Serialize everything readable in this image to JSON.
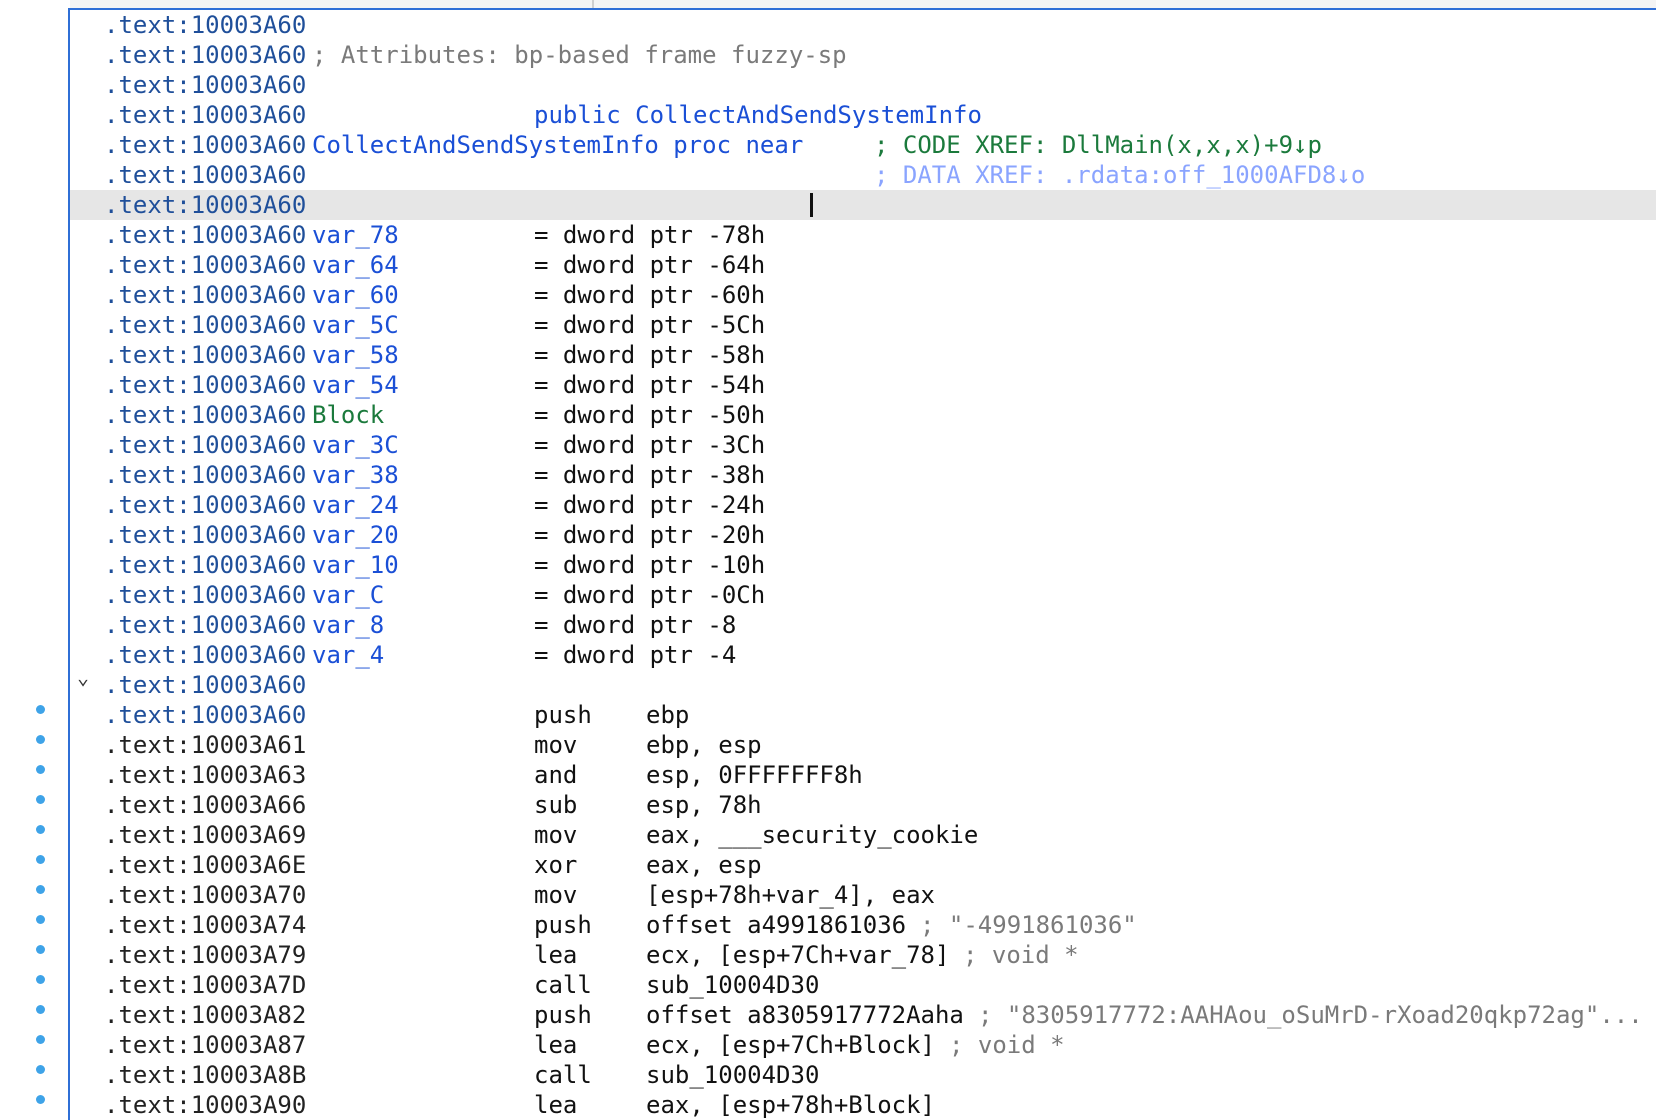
{
  "disassembly": {
    "header_lines": [
      {
        "addr": ".text:10003A60",
        "name": "",
        "comment": ""
      },
      {
        "addr": ".text:10003A60",
        "name": "",
        "comment": "; Attributes: bp-based frame fuzzy-sp"
      },
      {
        "addr": ".text:10003A60",
        "name": "",
        "comment": ""
      },
      {
        "addr": ".text:10003A60",
        "name": "",
        "public": "public CollectAndSendSystemInfo"
      },
      {
        "addr": ".text:10003A60",
        "name": "CollectAndSendSystemInfo proc near",
        "xref": "; CODE XREF: DllMain(x,x,x)+9↓p"
      },
      {
        "addr": ".text:10003A60",
        "name": "",
        "xref": "; DATA XREF: .rdata:off_1000AFD8↓o"
      },
      {
        "addr": ".text:10003A60",
        "name": "",
        "cursor": true
      }
    ],
    "vars": [
      {
        "addr": ".text:10003A60",
        "name": "var_78",
        "def": "= dword ptr -78h"
      },
      {
        "addr": ".text:10003A60",
        "name": "var_64",
        "def": "= dword ptr -64h"
      },
      {
        "addr": ".text:10003A60",
        "name": "var_60",
        "def": "= dword ptr -60h"
      },
      {
        "addr": ".text:10003A60",
        "name": "var_5C",
        "def": "= dword ptr -5Ch"
      },
      {
        "addr": ".text:10003A60",
        "name": "var_58",
        "def": "= dword ptr -58h"
      },
      {
        "addr": ".text:10003A60",
        "name": "var_54",
        "def": "= dword ptr -54h"
      },
      {
        "addr": ".text:10003A60",
        "name": "Block",
        "def": "= dword ptr -50h"
      },
      {
        "addr": ".text:10003A60",
        "name": "var_3C",
        "def": "= dword ptr -3Ch"
      },
      {
        "addr": ".text:10003A60",
        "name": "var_38",
        "def": "= dword ptr -38h"
      },
      {
        "addr": ".text:10003A60",
        "name": "var_24",
        "def": "= dword ptr -24h"
      },
      {
        "addr": ".text:10003A60",
        "name": "var_20",
        "def": "= dword ptr -20h"
      },
      {
        "addr": ".text:10003A60",
        "name": "var_10",
        "def": "= dword ptr -10h"
      },
      {
        "addr": ".text:10003A60",
        "name": "var_C",
        "def": "= dword ptr -0Ch"
      },
      {
        "addr": ".text:10003A60",
        "name": "var_8",
        "def": "= dword ptr -8"
      },
      {
        "addr": ".text:10003A60",
        "name": "var_4",
        "def": "= dword ptr -4"
      }
    ],
    "blank_addr": ".text:10003A60",
    "code": [
      {
        "addr": ".text:10003A60",
        "mn": "push",
        "op": "ebp",
        "cmt": ""
      },
      {
        "addr": ".text:10003A61",
        "mn": "mov",
        "op": "ebp, esp",
        "cmt": ""
      },
      {
        "addr": ".text:10003A63",
        "mn": "and",
        "op": "esp, 0FFFFFFF8h",
        "cmt": ""
      },
      {
        "addr": ".text:10003A66",
        "mn": "sub",
        "op": "esp, 78h",
        "cmt": ""
      },
      {
        "addr": ".text:10003A69",
        "mn": "mov",
        "op": "eax, ___security_cookie",
        "cmt": ""
      },
      {
        "addr": ".text:10003A6E",
        "mn": "xor",
        "op": "eax, esp",
        "cmt": ""
      },
      {
        "addr": ".text:10003A70",
        "mn": "mov",
        "op": "[esp+78h+var_4], eax",
        "cmt": ""
      },
      {
        "addr": ".text:10003A74",
        "mn": "push",
        "op": "offset a4991861036",
        "cmt": "; \"-4991861036\""
      },
      {
        "addr": ".text:10003A79",
        "mn": "lea",
        "op": "ecx, [esp+7Ch+var_78]",
        "cmt": "; void *"
      },
      {
        "addr": ".text:10003A7D",
        "mn": "call",
        "op": "sub_10004D30",
        "cmt": ""
      },
      {
        "addr": ".text:10003A82",
        "mn": "push",
        "op": "offset a8305917772Aaha",
        "cmt": "; \"8305917772:AAHAou_oSuMrD-rXoad20qkp72ag\"..."
      },
      {
        "addr": ".text:10003A87",
        "mn": "lea",
        "op": "ecx, [esp+7Ch+Block]",
        "cmt": "; void *"
      },
      {
        "addr": ".text:10003A8B",
        "mn": "call",
        "op": "sub_10004D30",
        "cmt": ""
      },
      {
        "addr": ".text:10003A90",
        "mn": "lea",
        "op": "eax, [esp+78h+Block]",
        "cmt": ""
      }
    ]
  },
  "colors": {
    "accent": "#2f6fd6",
    "name_blue": "#1a4fd6",
    "number_green": "#1b7a3c",
    "current_line": "#e6e6e6",
    "breakpoint_dot": "#3ea3e8"
  }
}
